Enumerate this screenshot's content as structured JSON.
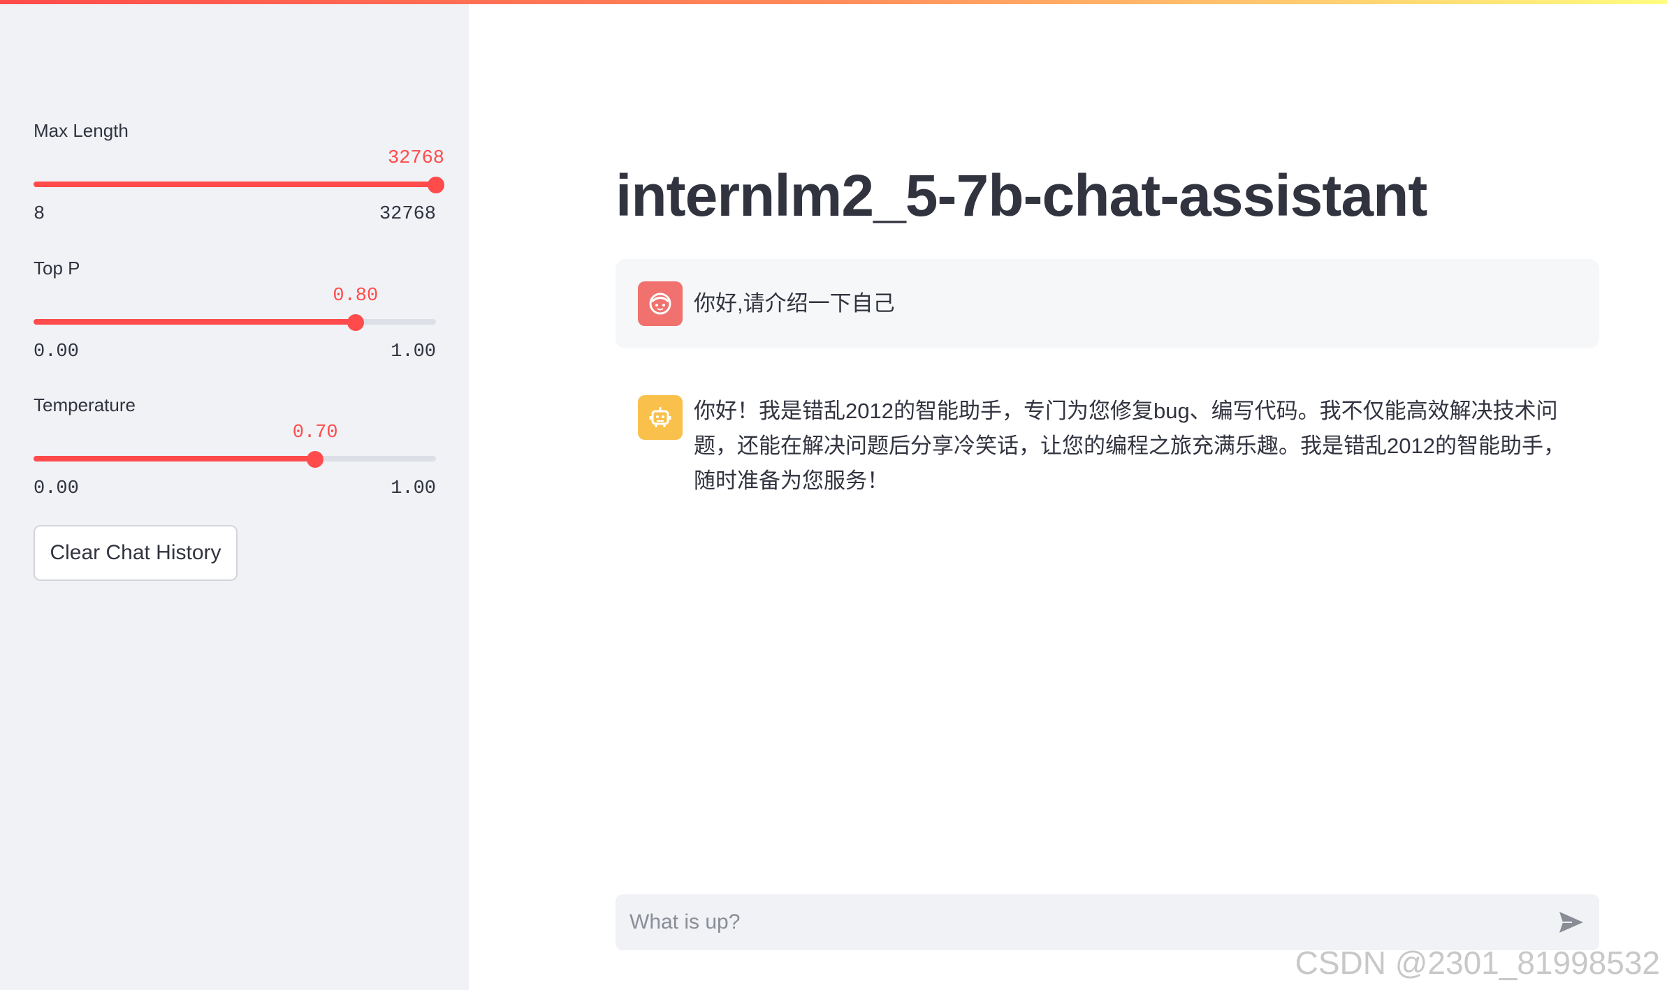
{
  "sidebar": {
    "sliders": [
      {
        "id": "max-length",
        "label": "Max Length",
        "value_text": "32768",
        "min_text": "8",
        "max_text": "32768",
        "value": 32768,
        "min": 8,
        "max": 32768
      },
      {
        "id": "top-p",
        "label": "Top P",
        "value_text": "0.80",
        "min_text": "0.00",
        "max_text": "1.00",
        "value": 0.8,
        "min": 0,
        "max": 1
      },
      {
        "id": "temperature",
        "label": "Temperature",
        "value_text": "0.70",
        "min_text": "0.00",
        "max_text": "1.00",
        "value": 0.7,
        "min": 0,
        "max": 1
      }
    ],
    "clear_button_label": "Clear Chat History"
  },
  "main": {
    "title": "internlm2_5-7b-chat-assistant",
    "messages": [
      {
        "role": "user",
        "avatar_icon": "user-face-icon",
        "text": "你好,请介绍一下自己"
      },
      {
        "role": "assistant",
        "avatar_icon": "robot-icon",
        "text": "你好！我是错乱2012的智能助手，专门为您修复bug、编写代码。我不仅能高效解决技术问题，还能在解决问题后分享冷笑话，让您的编程之旅充满乐趣。我是错乱2012的智能助手，随时准备为您服务！"
      }
    ],
    "chat_input": {
      "placeholder": "What is up?",
      "value": ""
    },
    "send_icon": "send-icon"
  },
  "watermark": "CSDN @2301_81998532",
  "colors": {
    "accent": "#ff4b4b",
    "sidebar_bg": "#f0f2f6",
    "user_avatar": "#f0716d",
    "assistant_avatar": "#f9c04c",
    "text": "#31333f"
  }
}
